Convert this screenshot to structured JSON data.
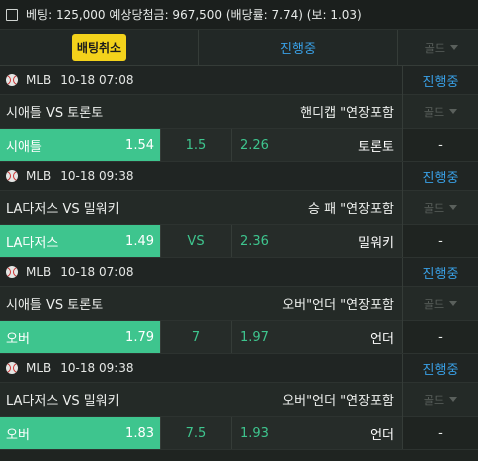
{
  "summary": "베팅: 125,000 예상당첨금: 967,500 (배당률: 7.74) (보: 1.03)",
  "actions": {
    "cancel_label": "배팅취소",
    "status_label": "진행중",
    "gold_label": "골드"
  },
  "colors": {
    "accent_green": "#3ec58e",
    "accent_blue": "#39a0e6",
    "cancel_yellow": "#f3d21b"
  },
  "groups": [
    {
      "league": "MLB",
      "time": "10-18 07:08",
      "status": "진행중",
      "match": "시애틀 VS 토론토",
      "market": "핸디캡 \"연장포함",
      "gold": "골드",
      "home": "시애틀",
      "home_odds": "1.54",
      "line": "1.5",
      "away_odds": "2.26",
      "away": "토론토",
      "extra": "-"
    },
    {
      "league": "MLB",
      "time": "10-18 09:38",
      "status": "진행중",
      "match": "LA다저스 VS 밀워키",
      "market": "승 패 \"연장포함",
      "gold": "골드",
      "home": "LA다저스",
      "home_odds": "1.49",
      "line": "VS",
      "away_odds": "2.36",
      "away": "밀워키",
      "extra": "-"
    },
    {
      "league": "MLB",
      "time": "10-18 07:08",
      "status": "진행중",
      "match": "시애틀 VS 토론토",
      "market": "오버\"언더 \"연장포함",
      "gold": "골드",
      "home": "오버",
      "home_odds": "1.79",
      "line": "7",
      "away_odds": "1.97",
      "away": "언더",
      "extra": "-"
    },
    {
      "league": "MLB",
      "time": "10-18 09:38",
      "status": "진행중",
      "match": "LA다저스 VS 밀워키",
      "market": "오버\"언더 \"연장포함",
      "gold": "골드",
      "home": "오버",
      "home_odds": "1.83",
      "line": "7.5",
      "away_odds": "1.93",
      "away": "언더",
      "extra": "-"
    }
  ]
}
